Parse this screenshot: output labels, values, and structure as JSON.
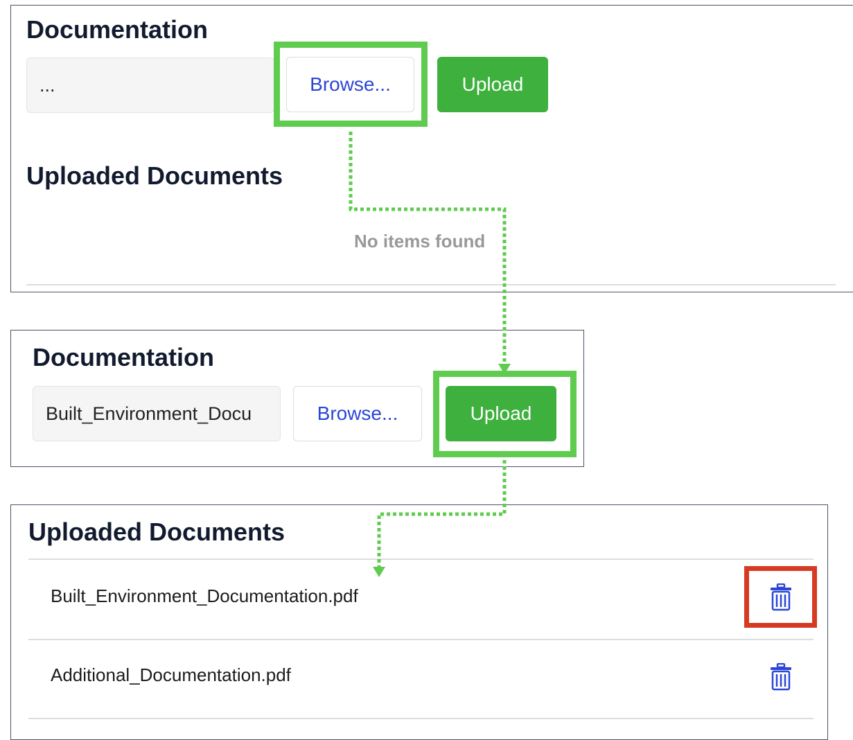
{
  "panel_before": {
    "heading": "Documentation",
    "file_field_value": "...",
    "browse_label": "Browse...",
    "upload_label": "Upload",
    "uploaded_heading": "Uploaded Documents",
    "empty_message": "No items found"
  },
  "panel_selected": {
    "heading": "Documentation",
    "file_field_value": "Built_Environment_Docu",
    "browse_label": "Browse...",
    "upload_label": "Upload"
  },
  "panel_after": {
    "heading": "Uploaded Documents",
    "documents": [
      {
        "name": "Built_Environment_Documentation.pdf",
        "icon": "trash-icon"
      },
      {
        "name": "Additional_Documentation.pdf",
        "icon": "trash-icon"
      }
    ]
  },
  "colors": {
    "primary_green": "#3db03d",
    "highlight_green": "#5fcb4f",
    "highlight_red": "#d63a22",
    "link_blue": "#2b46d6"
  }
}
